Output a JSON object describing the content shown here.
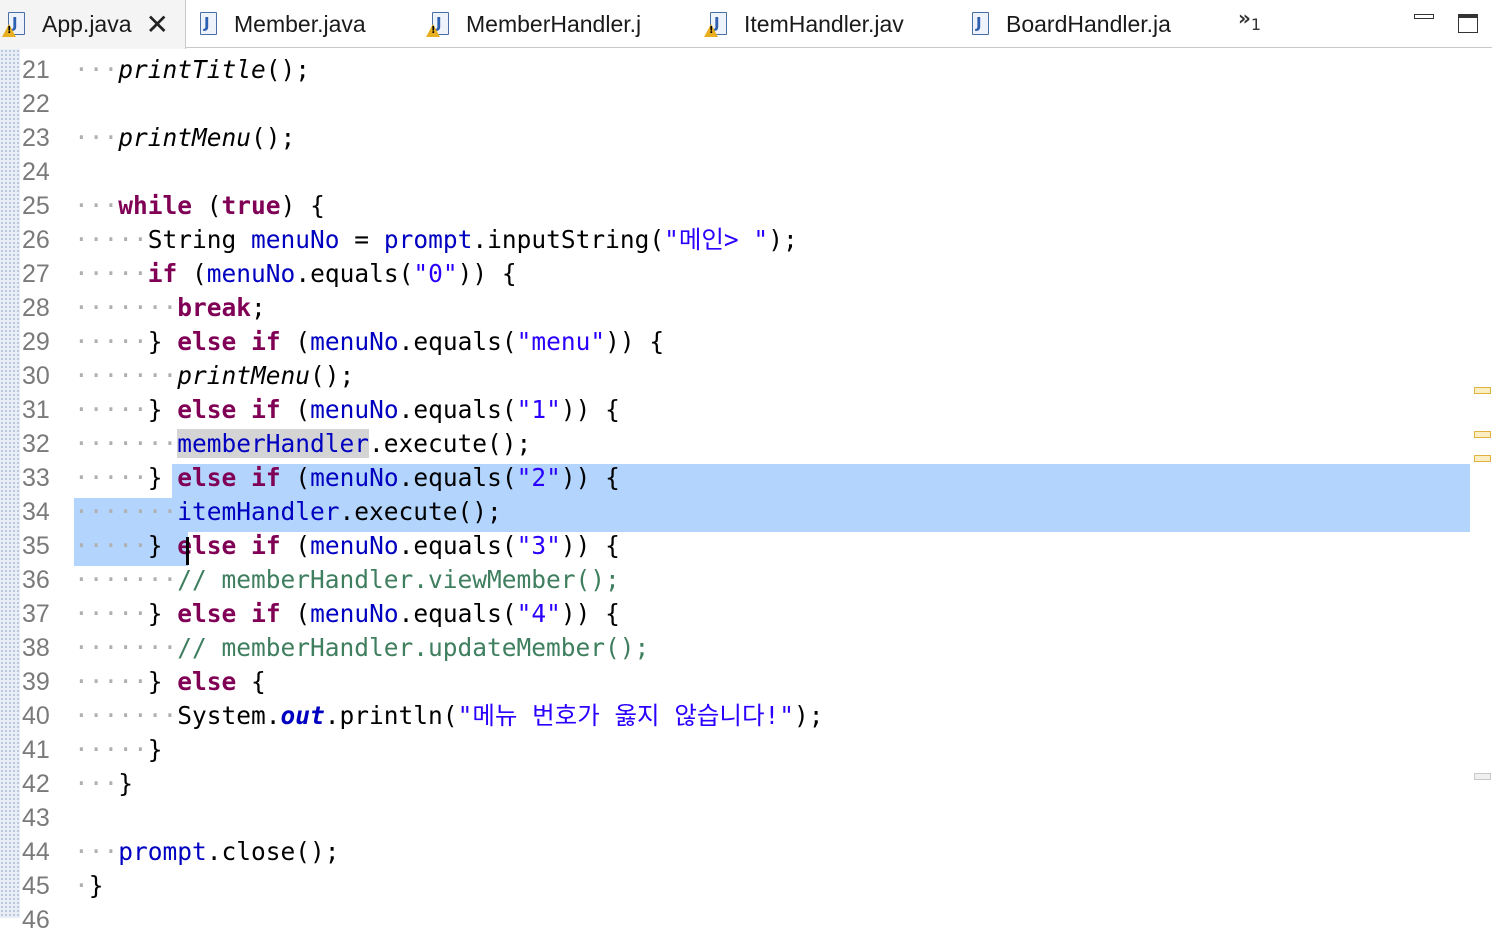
{
  "tabs": [
    {
      "label": "App.java",
      "warning": true,
      "active": true,
      "close": "✕"
    },
    {
      "label": "Member.java",
      "warning": false
    },
    {
      "label": "MemberHandler.j",
      "warning": true
    },
    {
      "label": "ItemHandler.jav",
      "warning": true
    },
    {
      "label": "BoardHandler.ja",
      "warning": false
    }
  ],
  "overflow": {
    "chevrons": "»",
    "count": "1"
  },
  "window_controls": [
    "minimize-icon",
    "maximize-icon"
  ],
  "editor": {
    "selection_color": "#b3d4fc",
    "lines": [
      {
        "num": "21",
        "indent": 3,
        "tokens": [
          {
            "t": "printTitle",
            "c": "sm"
          },
          {
            "t": "();"
          }
        ]
      },
      {
        "num": "22",
        "indent": 0,
        "tokens": []
      },
      {
        "num": "23",
        "indent": 3,
        "tokens": [
          {
            "t": "printMenu",
            "c": "sm"
          },
          {
            "t": "();"
          }
        ]
      },
      {
        "num": "24",
        "indent": 0,
        "tokens": []
      },
      {
        "num": "25",
        "indent": 3,
        "tokens": [
          {
            "t": "while",
            "c": "kw"
          },
          {
            "t": " (",
            "ws": true
          },
          {
            "t": "true",
            "c": "kw"
          },
          {
            "t": ") {",
            "ws": true
          }
        ]
      },
      {
        "num": "26",
        "indent": 5,
        "tokens": [
          {
            "t": "String "
          },
          {
            "t": "menuNo",
            "c": "fld"
          },
          {
            "t": " = "
          },
          {
            "t": "prompt",
            "c": "fld"
          },
          {
            "t": ".inputString("
          },
          {
            "t": "\"메인> \"",
            "c": "str"
          },
          {
            "t": ");"
          }
        ]
      },
      {
        "num": "27",
        "indent": 5,
        "tokens": [
          {
            "t": "if",
            "c": "kw"
          },
          {
            "t": " ("
          },
          {
            "t": "menuNo",
            "c": "fld"
          },
          {
            "t": ".equals("
          },
          {
            "t": "\"0\"",
            "c": "str"
          },
          {
            "t": ")) {"
          }
        ]
      },
      {
        "num": "28",
        "indent": 7,
        "tokens": [
          {
            "t": "break",
            "c": "kw"
          },
          {
            "t": ";"
          }
        ]
      },
      {
        "num": "29",
        "indent": 5,
        "tokens": [
          {
            "t": "} "
          },
          {
            "t": "else",
            "c": "kw"
          },
          {
            "t": " "
          },
          {
            "t": "if",
            "c": "kw"
          },
          {
            "t": " ("
          },
          {
            "t": "menuNo",
            "c": "fld"
          },
          {
            "t": ".equals("
          },
          {
            "t": "\"menu\"",
            "c": "str"
          },
          {
            "t": ")) {"
          }
        ]
      },
      {
        "num": "30",
        "indent": 7,
        "tokens": [
          {
            "t": "printMenu",
            "c": "sm"
          },
          {
            "t": "();"
          }
        ]
      },
      {
        "num": "31",
        "indent": 5,
        "tokens": [
          {
            "t": "} "
          },
          {
            "t": "else",
            "c": "kw"
          },
          {
            "t": " "
          },
          {
            "t": "if",
            "c": "kw"
          },
          {
            "t": " ("
          },
          {
            "t": "menuNo",
            "c": "fld"
          },
          {
            "t": ".equals("
          },
          {
            "t": "\"1\"",
            "c": "str"
          },
          {
            "t": ")) {"
          }
        ]
      },
      {
        "num": "32",
        "indent": 7,
        "tokens": [
          {
            "t": "memberHandler",
            "c": "fld occ"
          },
          {
            "t": ".execute();"
          }
        ]
      },
      {
        "num": "33",
        "indent": 5,
        "tokens": [
          {
            "t": "} "
          },
          {
            "t": "else",
            "c": "kw"
          },
          {
            "t": " "
          },
          {
            "t": "if",
            "c": "kw"
          },
          {
            "t": " ("
          },
          {
            "t": "menuNo",
            "c": "fld"
          },
          {
            "t": ".equals("
          },
          {
            "t": "\"2\"",
            "c": "str"
          },
          {
            "t": ")) {"
          }
        ]
      },
      {
        "num": "34",
        "indent": 7,
        "tokens": [
          {
            "t": "itemHandler",
            "c": "fld"
          },
          {
            "t": ".execute();"
          }
        ]
      },
      {
        "num": "35",
        "indent": 5,
        "tokens": [
          {
            "t": "} "
          },
          {
            "t": "else",
            "c": "kw"
          },
          {
            "t": " "
          },
          {
            "t": "if",
            "c": "kw"
          },
          {
            "t": " ("
          },
          {
            "t": "menuNo",
            "c": "fld"
          },
          {
            "t": ".equals("
          },
          {
            "t": "\"3\"",
            "c": "str"
          },
          {
            "t": ")) {"
          }
        ]
      },
      {
        "num": "36",
        "indent": 7,
        "tokens": [
          {
            "t": "// memberHandler.viewMember();",
            "c": "cmt"
          }
        ]
      },
      {
        "num": "37",
        "indent": 5,
        "tokens": [
          {
            "t": "} "
          },
          {
            "t": "else",
            "c": "kw"
          },
          {
            "t": " "
          },
          {
            "t": "if",
            "c": "kw"
          },
          {
            "t": " ("
          },
          {
            "t": "menuNo",
            "c": "fld"
          },
          {
            "t": ".equals("
          },
          {
            "t": "\"4\"",
            "c": "str"
          },
          {
            "t": ")) {"
          }
        ]
      },
      {
        "num": "38",
        "indent": 7,
        "tokens": [
          {
            "t": "// memberHandler.updateMember();",
            "c": "cmt"
          }
        ]
      },
      {
        "num": "39",
        "indent": 5,
        "tokens": [
          {
            "t": "} "
          },
          {
            "t": "else",
            "c": "kw"
          },
          {
            "t": " {"
          }
        ]
      },
      {
        "num": "40",
        "indent": 7,
        "tokens": [
          {
            "t": "System."
          },
          {
            "t": "out",
            "c": "smf"
          },
          {
            "t": ".println("
          },
          {
            "t": "\"메뉴 번호가 옳지 않습니다!\"",
            "c": "str"
          },
          {
            "t": ");"
          }
        ]
      },
      {
        "num": "41",
        "indent": 5,
        "tokens": [
          {
            "t": "}"
          }
        ]
      },
      {
        "num": "42",
        "indent": 3,
        "tokens": [
          {
            "t": "}"
          }
        ]
      },
      {
        "num": "43",
        "indent": 0,
        "tokens": []
      },
      {
        "num": "44",
        "indent": 3,
        "tokens": [
          {
            "t": "prompt",
            "c": "fld"
          },
          {
            "t": ".close();"
          }
        ]
      },
      {
        "num": "45",
        "indent": 1,
        "tokens": [
          {
            "t": "}"
          }
        ]
      },
      {
        "num": "46",
        "indent": 0,
        "tokens": []
      }
    ]
  }
}
